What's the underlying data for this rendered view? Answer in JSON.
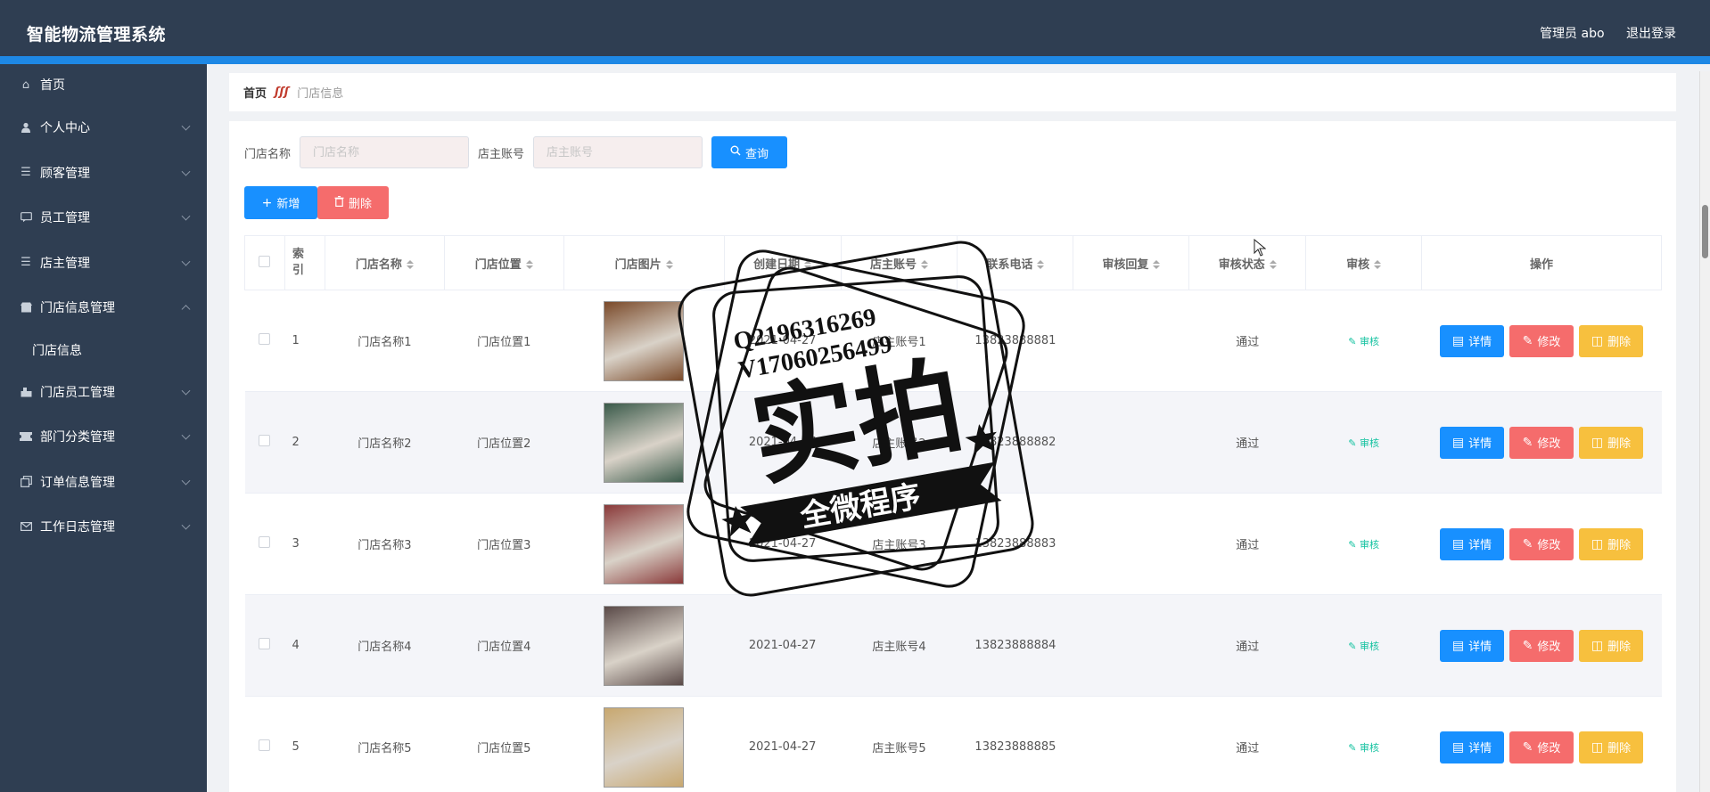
{
  "header": {
    "title": "智能物流管理系统",
    "user": "管理员 abo",
    "logout": "退出登录"
  },
  "sidebar": {
    "items": [
      {
        "label": "首页",
        "icon": "home-icon",
        "chevron": false
      },
      {
        "label": "个人中心",
        "icon": "user-icon",
        "chevron": true
      },
      {
        "label": "顾客管理",
        "icon": "list-icon",
        "chevron": true
      },
      {
        "label": "员工管理",
        "icon": "chat-icon",
        "chevron": true
      },
      {
        "label": "店主管理",
        "icon": "list-icon",
        "chevron": true
      },
      {
        "label": "门店信息管理",
        "icon": "shop-icon",
        "chevron": true,
        "expanded": true
      }
    ],
    "subitem": "门店信息",
    "items_after": [
      {
        "label": "门店员工管理",
        "icon": "stack-icon",
        "chevron": true
      },
      {
        "label": "部门分类管理",
        "icon": "ticket-icon",
        "chevron": true
      },
      {
        "label": "订单信息管理",
        "icon": "copy-icon",
        "chevron": true
      },
      {
        "label": "工作日志管理",
        "icon": "mail-icon",
        "chevron": true
      }
    ]
  },
  "breadcrumb": {
    "home": "首页",
    "current": "门店信息"
  },
  "search": {
    "store_name_label": "门店名称",
    "store_name_placeholder": "门店名称",
    "owner_label": "店主账号",
    "owner_placeholder": "店主账号",
    "search_button": "查询"
  },
  "actions": {
    "add": "新增",
    "delete": "删除"
  },
  "table": {
    "headers": [
      "索引",
      "门店名称",
      "门店位置",
      "门店图片",
      "创建日期",
      "店主账号",
      "联系电话",
      "审核回复",
      "审核状态",
      "审核",
      "操作"
    ],
    "rows": [
      {
        "index": "1",
        "name": "门店名称1",
        "location": "门店位置1",
        "date": "2021-04-27",
        "owner": "店主账号1",
        "phone": "13823888881",
        "reply": "",
        "status": "通过",
        "audit": "审核",
        "img_color": "#7a4a2a"
      },
      {
        "index": "2",
        "name": "门店名称2",
        "location": "门店位置2",
        "date": "2021-04-27",
        "owner": "店主账号2",
        "phone": "13823888882",
        "reply": "",
        "status": "通过",
        "audit": "审核",
        "img_color": "#3a5a4a"
      },
      {
        "index": "3",
        "name": "门店名称3",
        "location": "门店位置3",
        "date": "2021-04-27",
        "owner": "店主账号3",
        "phone": "13823888883",
        "reply": "",
        "status": "通过",
        "audit": "审核",
        "img_color": "#8a3a3a"
      },
      {
        "index": "4",
        "name": "门店名称4",
        "location": "门店位置4",
        "date": "2021-04-27",
        "owner": "店主账号4",
        "phone": "13823888884",
        "reply": "",
        "status": "通过",
        "audit": "审核",
        "img_color": "#5a4a48"
      },
      {
        "index": "5",
        "name": "门店名称5",
        "location": "门店位置5",
        "date": "2021-04-27",
        "owner": "店主账号5",
        "phone": "13823888885",
        "reply": "",
        "status": "通过",
        "audit": "审核",
        "img_color": "#c8a870"
      }
    ],
    "row_actions": {
      "detail": "详情",
      "edit": "修改",
      "delete": "删除"
    }
  },
  "watermark": {
    "line1": "Q2196316269",
    "line2": "V17060256499",
    "big": "实拍",
    "banner": "全微程序"
  },
  "colors": {
    "header_bg": "#2f3e52",
    "accent": "#1890ff",
    "danger": "#f56c6c",
    "warning": "#f7c03e",
    "success_link": "#13c2a0"
  }
}
